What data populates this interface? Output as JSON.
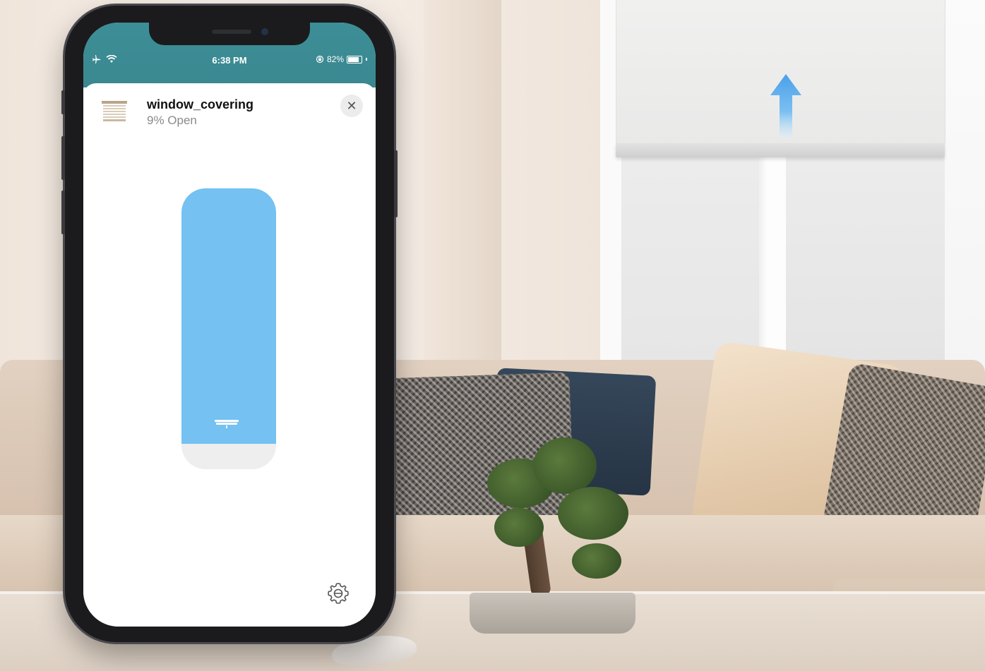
{
  "status_bar": {
    "time": "6:38 PM",
    "battery_text": "82%",
    "battery_level": 0.82,
    "left_icons": [
      "airplane-icon",
      "wifi-icon"
    ],
    "right_icons": [
      "orientation-lock-icon",
      "battery-icon"
    ],
    "background": "#3c8e97"
  },
  "device": {
    "name": "window_covering",
    "state": "9% Open",
    "icon": "blinds-icon"
  },
  "controls": {
    "close_icon": "close-icon",
    "close_glyph": "✕",
    "settings_icon": "gear-icon"
  },
  "slider": {
    "open_percent": 9,
    "fill_color": "#74c1f2",
    "track_color": "#eeeeee"
  },
  "scene": {
    "arrow_color": "#5aa9ee"
  }
}
